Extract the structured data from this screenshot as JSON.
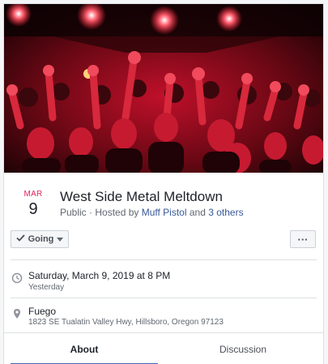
{
  "event": {
    "month": "MAR",
    "day": "9",
    "title": "West Side Metal Meltdown",
    "privacy": "Public",
    "hosted_prefix": " · Hosted by ",
    "host": "Muff Pistol",
    "and_text": " and ",
    "others": "3 others"
  },
  "actions": {
    "going_label": "Going",
    "more_label": "···"
  },
  "details": {
    "datetime": "Saturday, March 9, 2019 at 8 PM",
    "relative": "Yesterday",
    "venue": "Fuego",
    "address": "1823 SE Tualatin Valley Hwy, Hillsboro, Oregon 97123"
  },
  "tabs": [
    {
      "label": "About",
      "active": true
    },
    {
      "label": "Discussion",
      "active": false
    }
  ],
  "colors": {
    "date_accent": "#e0245e",
    "link": "#385898",
    "tab_underline": "#4267b2",
    "cover_tint": "#ff1a2e"
  },
  "icons": {
    "clock": "clock-icon",
    "location": "map-pin-icon",
    "check": "check-icon",
    "caret": "caret-down-icon"
  }
}
